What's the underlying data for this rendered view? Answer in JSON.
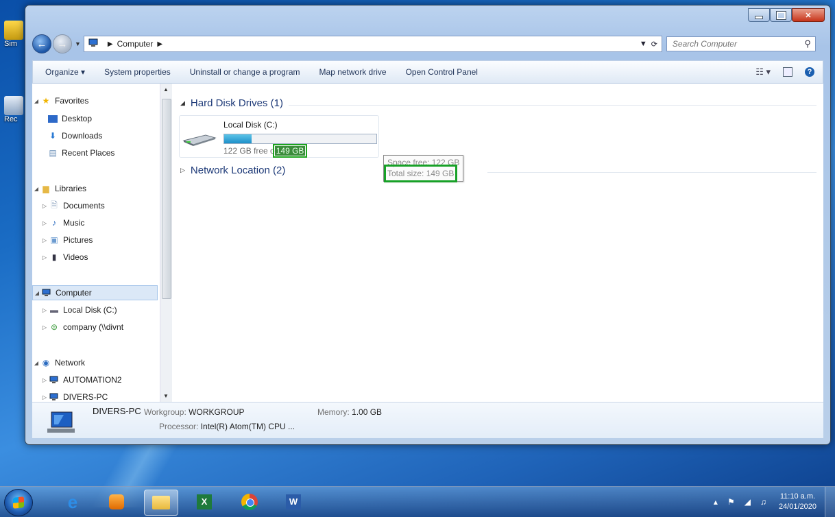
{
  "window": {
    "address": {
      "location": "Computer"
    },
    "search": {
      "placeholder": "Search Computer"
    }
  },
  "commandbar": {
    "organize": "Organize ▾",
    "system_properties": "System properties",
    "uninstall": "Uninstall or change a program",
    "map_drive": "Map network drive",
    "control_panel": "Open Control Panel"
  },
  "navpane": {
    "favorites": "Favorites",
    "desktop": "Desktop",
    "downloads": "Downloads",
    "recent": "Recent Places",
    "libraries": "Libraries",
    "documents": "Documents",
    "music": "Music",
    "pictures": "Pictures",
    "videos": "Videos",
    "computer": "Computer",
    "local_disk": "Local Disk (C:)",
    "company": "company (\\\\divnt",
    "network": "Network",
    "automation2": "AUTOMATION2",
    "divers_pc": "DIVERS-PC"
  },
  "content": {
    "hdd_group": "Hard Disk Drives (1)",
    "net_group": "Network Location (2)",
    "drive": {
      "name": "Local Disk (C:)",
      "free_prefix": "122 GB free o",
      "total_highlight": "149 GB",
      "used_fraction": 0.18
    },
    "tooltip": {
      "space_free": "Space free: 122 GB",
      "total_size": "Total size: 149 GB"
    }
  },
  "details": {
    "pc_name": "DIVERS-PC",
    "workgroup_label": "Workgroup:",
    "workgroup_value": "WORKGROUP",
    "memory_label": "Memory:",
    "memory_value": "1.00 GB",
    "processor_label": "Processor:",
    "processor_value": "Intel(R) Atom(TM) CPU ..."
  },
  "desktop": {
    "icon1_label": "Sim",
    "icon2_label": "Rec"
  },
  "taskbar": {
    "time": "11:10 a.m.",
    "date": "24/01/2020"
  },
  "colors": {
    "highlight_green": "#1ca31c",
    "selection_blue": "#dbe8f7"
  }
}
